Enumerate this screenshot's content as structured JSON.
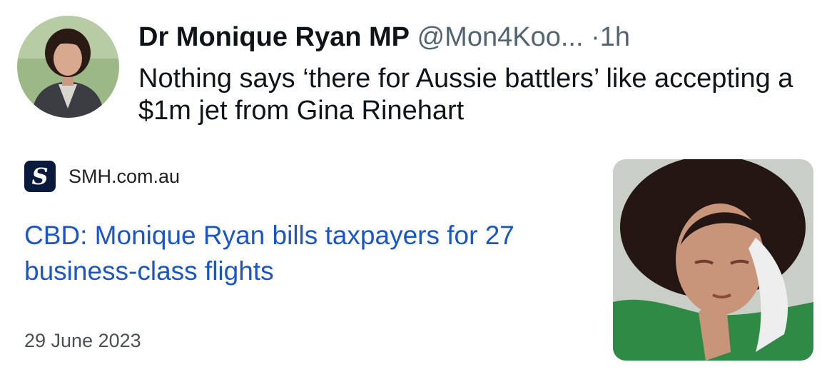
{
  "tweet": {
    "author_name": "Dr Monique Ryan MP",
    "author_handle": "@Mon4Koo...",
    "separator": "·",
    "time": "1h",
    "text": "Nothing says ‘there for Aussie battlers’ like accepting a $1m jet from Gina Rinehart"
  },
  "link_card": {
    "source_logo": "S",
    "source_name": "SMH.com.au",
    "headline": "CBD: Monique Ryan bills taxpayers for 27 business-class flights",
    "date": "29 June 2023"
  },
  "colors": {
    "headline_blue": "#1a56c9",
    "secondary_gray": "#536471",
    "logo_navy": "#0a1a3c"
  }
}
